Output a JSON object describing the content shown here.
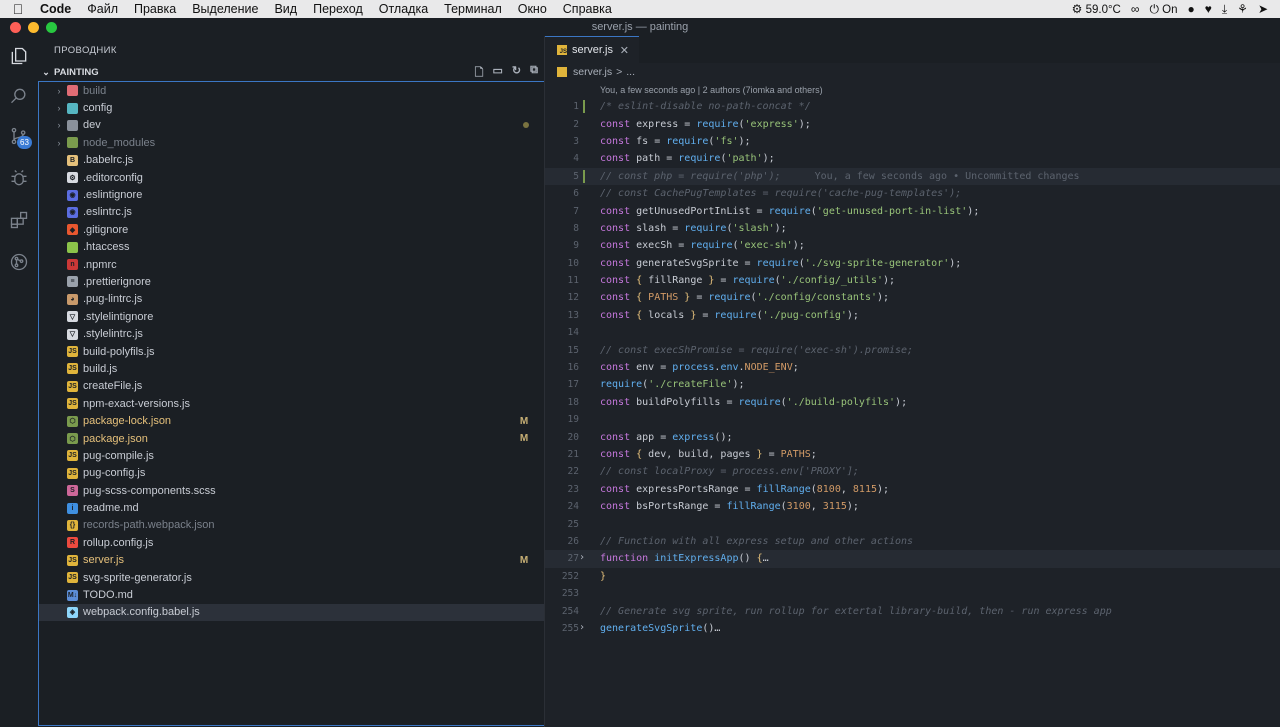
{
  "menubar": {
    "app": "Code",
    "items": [
      "Файл",
      "Правка",
      "Выделение",
      "Вид",
      "Переход",
      "Отладка",
      "Терминал",
      "Окно",
      "Справка"
    ],
    "temperature": "59.0°C",
    "vpn": "On"
  },
  "window": {
    "title": "server.js — painting"
  },
  "activity": {
    "scm_badge": "63"
  },
  "sidebar": {
    "title": "ПРОВОДНИК",
    "folder": "PAINTING",
    "items": [
      {
        "name": "build",
        "kind": "folder",
        "icon": "folder-build-icon",
        "color": "#e06c75",
        "state": "dim"
      },
      {
        "name": "config",
        "kind": "folder",
        "icon": "folder-config-icon",
        "color": "#56b6c2",
        "state": ""
      },
      {
        "name": "dev",
        "kind": "folder",
        "icon": "folder-icon",
        "color": "#8a919b",
        "state": "mod-dot"
      },
      {
        "name": "node_modules",
        "kind": "folder",
        "icon": "folder-node-icon",
        "color": "#7a9b4d",
        "state": "dim"
      },
      {
        "name": ".babelrc.js",
        "kind": "file",
        "icon": "babel-icon",
        "color": "#e5c07b",
        "glyph": "B",
        "state": ""
      },
      {
        "name": ".editorconfig",
        "kind": "file",
        "icon": "editorconfig-icon",
        "color": "#d7dae0",
        "glyph": "⚙",
        "state": ""
      },
      {
        "name": ".eslintignore",
        "kind": "file",
        "icon": "eslint-icon",
        "color": "#5b6de0",
        "glyph": "◉",
        "state": ""
      },
      {
        "name": ".eslintrc.js",
        "kind": "file",
        "icon": "eslint-icon",
        "color": "#5b6de0",
        "glyph": "◉",
        "state": ""
      },
      {
        "name": ".gitignore",
        "kind": "file",
        "icon": "git-icon",
        "color": "#e8572f",
        "glyph": "◆",
        "state": ""
      },
      {
        "name": ".htaccess",
        "kind": "file",
        "icon": "htaccess-icon",
        "color": "#8bc34a",
        "glyph": "",
        "state": ""
      },
      {
        "name": ".npmrc",
        "kind": "file",
        "icon": "npm-icon",
        "color": "#cb3837",
        "glyph": "n",
        "state": ""
      },
      {
        "name": ".prettierignore",
        "kind": "file",
        "icon": "prettier-icon",
        "color": "#9aa1ab",
        "glyph": "≡",
        "state": ""
      },
      {
        "name": ".pug-lintrc.js",
        "kind": "file",
        "icon": "pug-icon",
        "color": "#c99a6b",
        "glyph": "◕",
        "state": ""
      },
      {
        "name": ".stylelintignore",
        "kind": "file",
        "icon": "stylelint-icon",
        "color": "#d7dae0",
        "glyph": "▽",
        "state": ""
      },
      {
        "name": ".stylelintrc.js",
        "kind": "file",
        "icon": "stylelint-icon",
        "color": "#d7dae0",
        "glyph": "▽",
        "state": ""
      },
      {
        "name": "build-polyfils.js",
        "kind": "file",
        "icon": "js-icon",
        "color": "#e0b43b",
        "glyph": "JS",
        "state": ""
      },
      {
        "name": "build.js",
        "kind": "file",
        "icon": "js-icon",
        "color": "#e0b43b",
        "glyph": "JS",
        "state": ""
      },
      {
        "name": "createFile.js",
        "kind": "file",
        "icon": "js-icon",
        "color": "#e0b43b",
        "glyph": "JS",
        "state": ""
      },
      {
        "name": "npm-exact-versions.js",
        "kind": "file",
        "icon": "js-icon",
        "color": "#e0b43b",
        "glyph": "JS",
        "state": ""
      },
      {
        "name": "package-lock.json",
        "kind": "file",
        "icon": "nodejs-icon",
        "color": "#7a9b4d",
        "glyph": "⬡",
        "state": "M"
      },
      {
        "name": "package.json",
        "kind": "file",
        "icon": "nodejs-icon",
        "color": "#7a9b4d",
        "glyph": "⬡",
        "state": "M"
      },
      {
        "name": "pug-compile.js",
        "kind": "file",
        "icon": "js-icon",
        "color": "#e0b43b",
        "glyph": "JS",
        "state": ""
      },
      {
        "name": "pug-config.js",
        "kind": "file",
        "icon": "js-icon",
        "color": "#e0b43b",
        "glyph": "JS",
        "state": ""
      },
      {
        "name": "pug-scss-components.scss",
        "kind": "file",
        "icon": "sass-icon",
        "color": "#cd6799",
        "glyph": "S",
        "state": ""
      },
      {
        "name": "readme.md",
        "kind": "file",
        "icon": "info-icon",
        "color": "#3f8fe0",
        "glyph": "i",
        "state": ""
      },
      {
        "name": "records-path.webpack.json",
        "kind": "file",
        "icon": "json-icon",
        "color": "#e0b43b",
        "glyph": "{}",
        "state": "dim"
      },
      {
        "name": "rollup.config.js",
        "kind": "file",
        "icon": "rollup-icon",
        "color": "#ec4a3f",
        "glyph": "R",
        "state": ""
      },
      {
        "name": "server.js",
        "kind": "file",
        "icon": "js-icon",
        "color": "#e0b43b",
        "glyph": "JS",
        "state": "M"
      },
      {
        "name": "svg-sprite-generator.js",
        "kind": "file",
        "icon": "js-icon",
        "color": "#e0b43b",
        "glyph": "JS",
        "state": ""
      },
      {
        "name": "TODO.md",
        "kind": "file",
        "icon": "markdown-icon",
        "color": "#5c8dd6",
        "glyph": "M↓",
        "state": ""
      },
      {
        "name": "webpack.config.babel.js",
        "kind": "file",
        "icon": "webpack-icon",
        "color": "#8ed6fb",
        "glyph": "◈",
        "state": "sel"
      }
    ]
  },
  "editor": {
    "tab": "server.js",
    "breadcrumb": [
      "server.js",
      ">",
      "..."
    ],
    "blame_header": "You, a few seconds ago | 2 authors (7iomka and others)",
    "lines": [
      {
        "n": "1",
        "mark": true,
        "tokens": [
          [
            "c",
            "/* eslint-disable no-path-concat */"
          ]
        ]
      },
      {
        "n": "2",
        "tokens": [
          [
            "k",
            "const"
          ],
          [
            "",
            " express = "
          ],
          [
            "f",
            "require"
          ],
          [
            "",
            "("
          ],
          [
            "s",
            "'express'"
          ],
          [
            "",
            ");"
          ]
        ]
      },
      {
        "n": "3",
        "tokens": [
          [
            "k",
            "const"
          ],
          [
            "",
            " fs = "
          ],
          [
            "f",
            "require"
          ],
          [
            "",
            "("
          ],
          [
            "s",
            "'fs'"
          ],
          [
            "",
            ");"
          ]
        ]
      },
      {
        "n": "4",
        "tokens": [
          [
            "k",
            "const"
          ],
          [
            "",
            " path = "
          ],
          [
            "f",
            "require"
          ],
          [
            "",
            "("
          ],
          [
            "s",
            "'path'"
          ],
          [
            "",
            ");"
          ]
        ]
      },
      {
        "n": "5",
        "mark": true,
        "current": true,
        "tokens": [
          [
            "c",
            "// const php = require('php');"
          ]
        ],
        "blame": "You, a few seconds ago • Uncommitted changes"
      },
      {
        "n": "6",
        "tokens": [
          [
            "c",
            "// const CachePugTemplates = require('cache-pug-templates');"
          ]
        ]
      },
      {
        "n": "7",
        "tokens": [
          [
            "k",
            "const"
          ],
          [
            "",
            " getUnusedPortInList = "
          ],
          [
            "f",
            "require"
          ],
          [
            "",
            "("
          ],
          [
            "s",
            "'get-unused-port-in-list'"
          ],
          [
            "",
            ");"
          ]
        ]
      },
      {
        "n": "8",
        "tokens": [
          [
            "k",
            "const"
          ],
          [
            "",
            " slash = "
          ],
          [
            "f",
            "require"
          ],
          [
            "",
            "("
          ],
          [
            "s",
            "'slash'"
          ],
          [
            "",
            ");"
          ]
        ]
      },
      {
        "n": "9",
        "tokens": [
          [
            "k",
            "const"
          ],
          [
            "",
            " execSh = "
          ],
          [
            "f",
            "require"
          ],
          [
            "",
            "("
          ],
          [
            "s",
            "'exec-sh'"
          ],
          [
            "",
            ");"
          ]
        ]
      },
      {
        "n": "10",
        "tokens": [
          [
            "k",
            "const"
          ],
          [
            "",
            " generateSvgSprite = "
          ],
          [
            "f",
            "require"
          ],
          [
            "",
            "("
          ],
          [
            "s",
            "'./svg-sprite-generator'"
          ],
          [
            "",
            ");"
          ]
        ]
      },
      {
        "n": "11",
        "tokens": [
          [
            "k",
            "const"
          ],
          [
            "p",
            " { "
          ],
          [
            "",
            "fillRange"
          ],
          [
            "p",
            " }"
          ],
          [
            "",
            " = "
          ],
          [
            "f",
            "require"
          ],
          [
            "",
            "("
          ],
          [
            "s",
            "'./config/_utils'"
          ],
          [
            "",
            ");"
          ]
        ]
      },
      {
        "n": "12",
        "tokens": [
          [
            "k",
            "const"
          ],
          [
            "p",
            " { "
          ],
          [
            "cn",
            "PATHS"
          ],
          [
            "p",
            " }"
          ],
          [
            "",
            " = "
          ],
          [
            "f",
            "require"
          ],
          [
            "",
            "("
          ],
          [
            "s",
            "'./config/constants'"
          ],
          [
            "",
            ");"
          ]
        ]
      },
      {
        "n": "13",
        "tokens": [
          [
            "k",
            "const"
          ],
          [
            "p",
            " { "
          ],
          [
            "",
            "locals"
          ],
          [
            "p",
            " }"
          ],
          [
            "",
            " = "
          ],
          [
            "f",
            "require"
          ],
          [
            "",
            "("
          ],
          [
            "s",
            "'./pug-config'"
          ],
          [
            "",
            ");"
          ]
        ]
      },
      {
        "n": "14",
        "tokens": []
      },
      {
        "n": "15",
        "tokens": [
          [
            "c",
            "// const execShPromise = require('exec-sh').promise;"
          ]
        ]
      },
      {
        "n": "16",
        "tokens": [
          [
            "k",
            "const"
          ],
          [
            "",
            " env = "
          ],
          [
            "f",
            "process"
          ],
          [
            "",
            "."
          ],
          [
            "f",
            "env"
          ],
          [
            "",
            "."
          ],
          [
            "cn",
            "NODE_ENV"
          ],
          [
            "",
            ";"
          ]
        ]
      },
      {
        "n": "17",
        "tokens": [
          [
            "f",
            "require"
          ],
          [
            "",
            "("
          ],
          [
            "s",
            "'./createFile'"
          ],
          [
            "",
            ");"
          ]
        ]
      },
      {
        "n": "18",
        "tokens": [
          [
            "k",
            "const"
          ],
          [
            "",
            " buildPolyfills = "
          ],
          [
            "f",
            "require"
          ],
          [
            "",
            "("
          ],
          [
            "s",
            "'./build-polyfils'"
          ],
          [
            "",
            ");"
          ]
        ]
      },
      {
        "n": "19",
        "tokens": []
      },
      {
        "n": "20",
        "tokens": [
          [
            "k",
            "const"
          ],
          [
            "",
            " app = "
          ],
          [
            "f",
            "express"
          ],
          [
            "",
            "();"
          ]
        ]
      },
      {
        "n": "21",
        "tokens": [
          [
            "k",
            "const"
          ],
          [
            "p",
            " { "
          ],
          [
            "",
            "dev, build, pages"
          ],
          [
            "p",
            " }"
          ],
          [
            "",
            " = "
          ],
          [
            "cn",
            "PATHS"
          ],
          [
            "",
            ";"
          ]
        ]
      },
      {
        "n": "22",
        "tokens": [
          [
            "c",
            "// const localProxy = process.env['PROXY'];"
          ]
        ]
      },
      {
        "n": "23",
        "tokens": [
          [
            "k",
            "const"
          ],
          [
            "",
            " expressPortsRange = "
          ],
          [
            "f",
            "fillRange"
          ],
          [
            "",
            "("
          ],
          [
            "cn",
            "8100"
          ],
          [
            "",
            ", "
          ],
          [
            "cn",
            "8115"
          ],
          [
            "",
            ");"
          ]
        ]
      },
      {
        "n": "24",
        "tokens": [
          [
            "k",
            "const"
          ],
          [
            "",
            " bsPortsRange = "
          ],
          [
            "f",
            "fillRange"
          ],
          [
            "",
            "("
          ],
          [
            "cn",
            "3100"
          ],
          [
            "",
            ", "
          ],
          [
            "cn",
            "3115"
          ],
          [
            "",
            ");"
          ]
        ]
      },
      {
        "n": "25",
        "tokens": []
      },
      {
        "n": "26",
        "tokens": [
          [
            "c",
            "// Function with all express setup and other actions"
          ]
        ]
      },
      {
        "n": "27",
        "fold": true,
        "current": true,
        "tokens": [
          [
            "k",
            "function"
          ],
          [
            "",
            " "
          ],
          [
            "f",
            "initExpressApp"
          ],
          [
            "",
            "() "
          ],
          [
            "p",
            "{"
          ],
          [
            "",
            "…"
          ]
        ]
      },
      {
        "n": "252",
        "tokens": [
          [
            "p",
            "}"
          ]
        ]
      },
      {
        "n": "253",
        "tokens": []
      },
      {
        "n": "254",
        "tokens": [
          [
            "c",
            "// Generate svg sprite, run rollup for extertal library-build, then - run express app"
          ]
        ]
      },
      {
        "n": "255",
        "fold": true,
        "tokens": [
          [
            "f",
            "generateSvgSprite"
          ],
          [
            "",
            "()"
          ],
          [
            "",
            "…"
          ]
        ]
      }
    ]
  }
}
